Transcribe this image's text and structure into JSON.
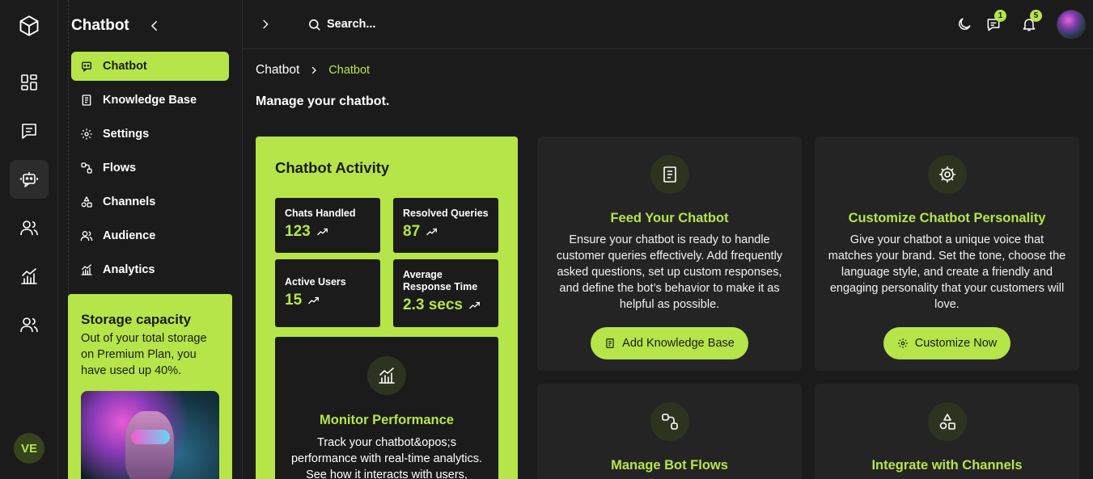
{
  "colors": {
    "accent": "#b5e548",
    "background": "#1b1b1b",
    "card": "#242424"
  },
  "rail": {
    "logo_icon": "cube-icon",
    "items": [
      {
        "icon": "dashboard-icon"
      },
      {
        "icon": "messages-icon"
      },
      {
        "icon": "bot-icon",
        "active": true
      },
      {
        "icon": "users-icon"
      },
      {
        "icon": "analytics-icon"
      },
      {
        "icon": "team-icon"
      }
    ],
    "user_initials": "VE"
  },
  "sidebar": {
    "title": "Chatbot",
    "items": [
      {
        "label": "Chatbot",
        "icon": "bot-icon",
        "active": true
      },
      {
        "label": "Knowledge Base",
        "icon": "book-icon"
      },
      {
        "label": "Settings",
        "icon": "gear-icon"
      },
      {
        "label": "Flows",
        "icon": "flows-icon"
      },
      {
        "label": "Channels",
        "icon": "shapes-icon"
      },
      {
        "label": "Audience",
        "icon": "users-icon"
      },
      {
        "label": "Analytics",
        "icon": "chart-icon"
      }
    ],
    "storage": {
      "title": "Storage capacity",
      "text": "Out of your total storage on Premium Plan, you have used up 40%."
    }
  },
  "topbar": {
    "search_placeholder": "Search...",
    "messages_badge": "1",
    "notifications_badge": "5"
  },
  "breadcrumb": {
    "root": "Chatbot",
    "current": "Chatbot"
  },
  "page_subtitle": "Manage your chatbot.",
  "activity": {
    "title": "Chatbot Activity",
    "stats": [
      {
        "label": "Chats Handled",
        "value": "123"
      },
      {
        "label": "Resolved Queries",
        "value": "87"
      },
      {
        "label": "Active Users",
        "value": "15"
      },
      {
        "label": "Average Response Time",
        "value": "2.3 secs"
      }
    ],
    "monitor": {
      "title": "Monitor Performance",
      "text": "Track your chatbot&opos;s performance with real-time analytics. See how it interacts with users,"
    }
  },
  "cards": [
    {
      "title": "Feed Your Chatbot",
      "icon": "book-icon",
      "text": "Ensure your chatbot is ready to handle customer queries effectively. Add frequently asked questions, set up custom responses, and define the bot’s behavior to make it as helpful as possible.",
      "button": "Add Knowledge Base"
    },
    {
      "title": "Customize Chatbot Personality",
      "icon": "gear-icon",
      "text": "Give your chatbot a unique voice that matches your brand. Set the tone, choose the language style, and create a friendly and engaging personality that your customers will love.",
      "button": "Customize Now"
    },
    {
      "title": "Manage Bot Flows",
      "icon": "flows-icon"
    },
    {
      "title": "Integrate with Channels",
      "icon": "shapes-icon"
    }
  ]
}
